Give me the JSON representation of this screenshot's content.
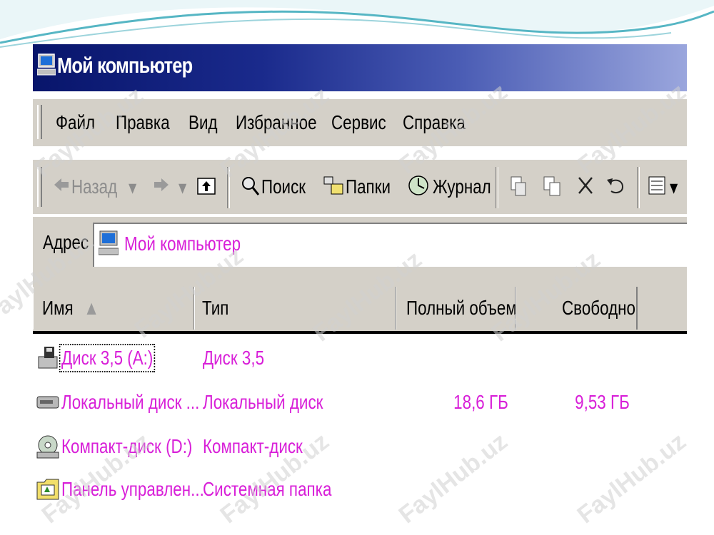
{
  "window": {
    "title": "Мой компьютер"
  },
  "menu": [
    "Файл",
    "Правка",
    "Вид",
    "Избранное",
    "Сервис",
    "Справка"
  ],
  "toolbar": {
    "back": "Назад",
    "search": "Поиск",
    "folders": "Папки",
    "history": "Журнал"
  },
  "address": {
    "label": "Адрес",
    "value": "Мой компьютер"
  },
  "columns": {
    "name": "Имя",
    "type": "Тип",
    "total": "Полный объем",
    "free": "Свободно"
  },
  "items": [
    {
      "name": "Диск 3,5 (A:)",
      "type": "Диск 3,5",
      "total": "",
      "free": "",
      "icon": "floppy-drive-icon"
    },
    {
      "name": "Локальный диск ...",
      "type": "Локальный диск",
      "total": "18,6 ГБ",
      "free": "9,53 ГБ",
      "icon": "hard-drive-icon"
    },
    {
      "name": "Компакт-диск (D:)",
      "type": "Компакт-диск",
      "total": "",
      "free": "",
      "icon": "cd-drive-icon"
    },
    {
      "name": "Панель управлен...",
      "type": "Системная папка",
      "total": "",
      "free": "",
      "icon": "control-panel-icon"
    }
  ],
  "watermark": "FaylHub.uz",
  "colors": {
    "titlebar": "#08156b",
    "item_text": "#d81fd8",
    "chrome": "#d4d0c8"
  }
}
